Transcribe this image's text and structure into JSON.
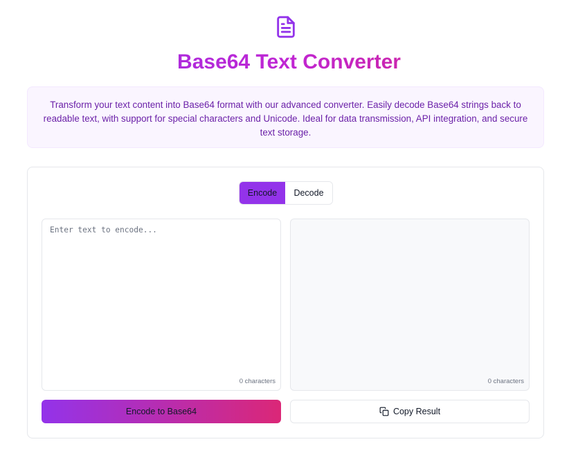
{
  "header": {
    "icon": "file-text-icon",
    "title": "Base64 Text Converter"
  },
  "description": "Transform your text content into Base64 format with our advanced converter. Easily decode Base64 strings back to readable text, with support for special characters and Unicode. Ideal for data transmission, API integration, and secure text storage.",
  "tabs": {
    "encode_label": "Encode",
    "decode_label": "Decode",
    "active": "Encode"
  },
  "input": {
    "value": "",
    "placeholder": "Enter text to encode...",
    "char_count": "0 characters"
  },
  "output": {
    "value": "",
    "char_count": "0 characters"
  },
  "actions": {
    "primary_label": "Encode to Base64",
    "copy_label": "Copy Result",
    "copy_icon": "copy-icon"
  },
  "colors": {
    "accent": "#9333ea",
    "accent_end": "#db2777",
    "desc_bg": "#faf5ff",
    "desc_text": "#6b21a8"
  }
}
